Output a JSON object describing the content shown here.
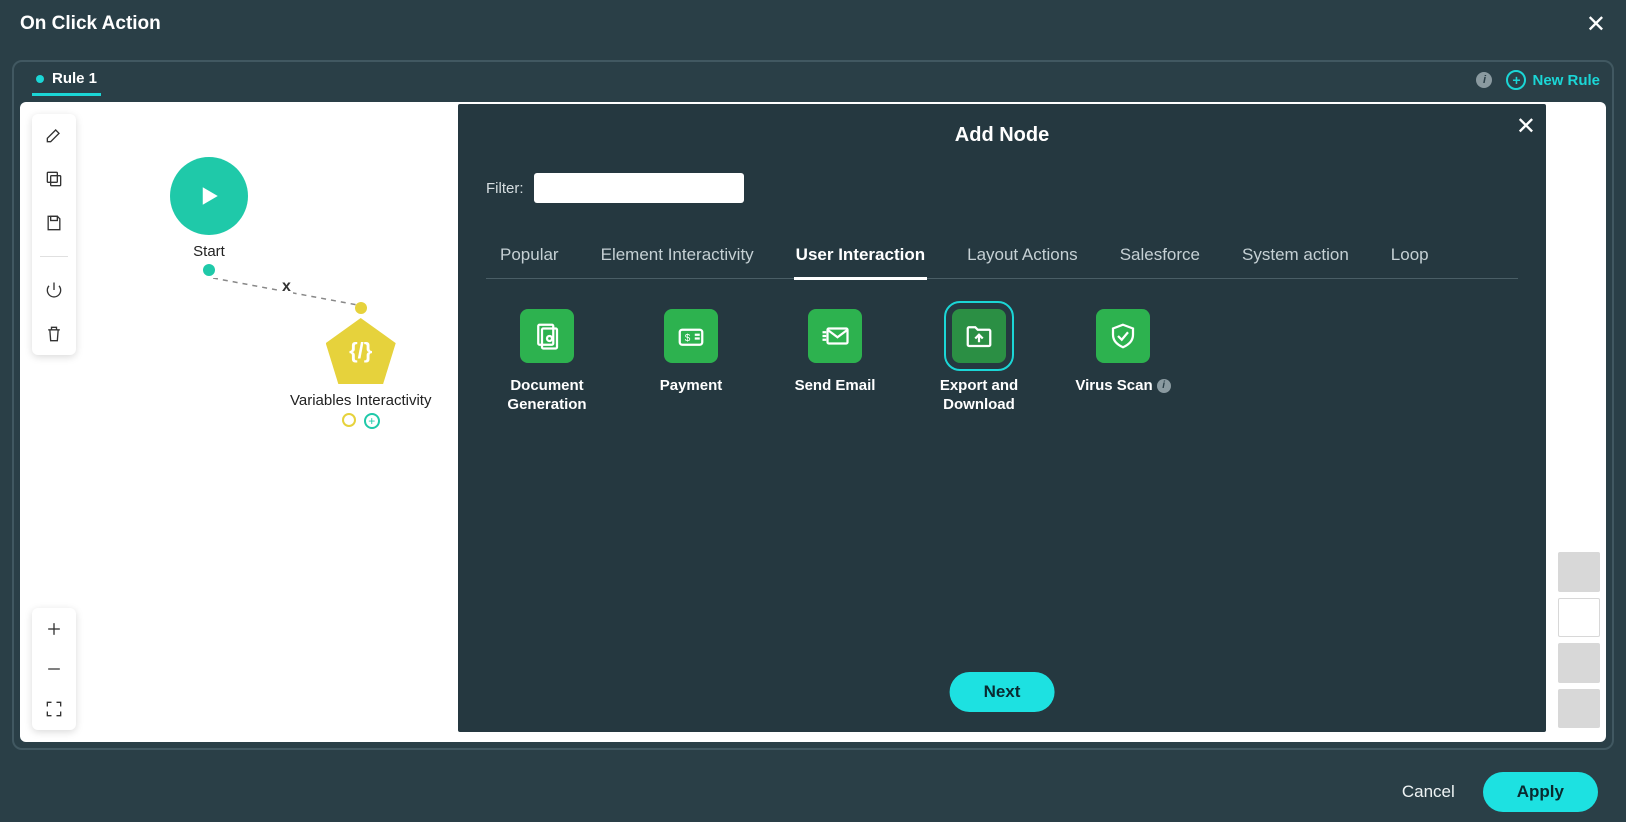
{
  "header": {
    "title": "On Click Action"
  },
  "tabs": {
    "rule_label": "Rule 1",
    "new_rule": "New Rule"
  },
  "flow": {
    "start_label": "Start",
    "var_label": "Variables Interactivity",
    "var_glyph": "{/}"
  },
  "modal": {
    "title": "Add Node",
    "filter_label": "Filter:",
    "filter_value": "",
    "categories": {
      "popular": "Popular",
      "element": "Element Interactivity",
      "user": "User Interaction",
      "layout": "Layout Actions",
      "salesforce": "Salesforce",
      "system": "System action",
      "loop": "Loop"
    },
    "active_category": "user",
    "nodes": {
      "docgen": "Document Generation",
      "payment": "Payment",
      "sendemail": "Send Email",
      "export": "Export and Download",
      "virus": "Virus Scan"
    },
    "selected_node": "export",
    "next": "Next"
  },
  "footer": {
    "cancel": "Cancel",
    "apply": "Apply"
  }
}
